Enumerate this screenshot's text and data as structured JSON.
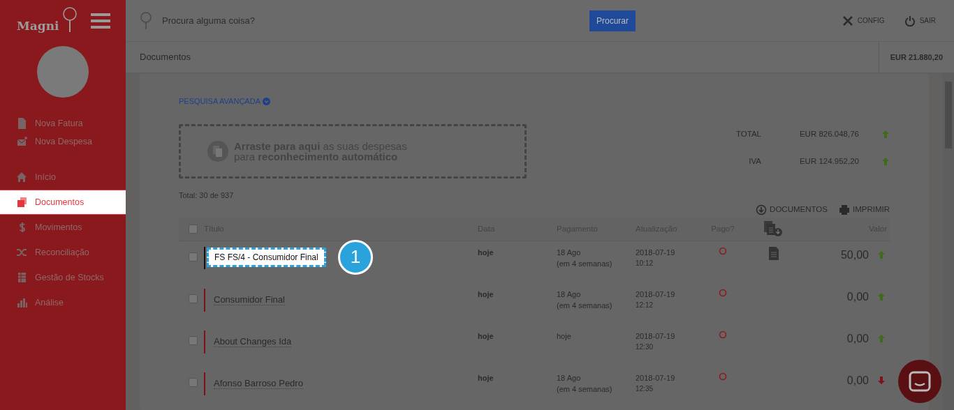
{
  "sidebar": {
    "logo": "Magni",
    "items": [
      {
        "label": "Nova Fatura",
        "selected": false
      },
      {
        "label": "Nova Despesa",
        "selected": false
      },
      {
        "label": "Início",
        "selected": false
      },
      {
        "label": "Documentos",
        "selected": true
      },
      {
        "label": "Movimentos",
        "selected": false
      },
      {
        "label": "Reconciliação",
        "selected": false
      },
      {
        "label": "Gestão de Stocks",
        "selected": false
      },
      {
        "label": "Análise",
        "selected": false
      }
    ]
  },
  "topbar": {
    "search": {
      "placeholder": "Procura alguma coisa?"
    },
    "search_button": "Procurar",
    "actions": [
      {
        "label": "CONFIG"
      },
      {
        "label": "SAIR"
      }
    ]
  },
  "header": {
    "title": "Documentos",
    "balance": "EUR 21.880,20"
  },
  "advanced_search": "PESQUISA AVANÇADA",
  "dropzone": {
    "line_1": "**Arraste para aqui** as suas despesas",
    "line_2": "para **reconhecimento automático**"
  },
  "totals": [
    {
      "label": "TOTAL",
      "value": "EUR 826.048,76",
      "rising": true
    },
    {
      "label": "IVA",
      "value": "EUR 124.952,20",
      "rising": true
    }
  ],
  "count": "Total: 30 de 937",
  "table_actions": [
    {
      "label": "DOCUMENTOS"
    },
    {
      "label": "IMPRIMIR"
    }
  ],
  "table": {
    "select_all_checked": false,
    "columns": [
      {
        "kind": "text",
        "label": "Título"
      },
      {
        "kind": "text",
        "label": "Data"
      },
      {
        "kind": "text",
        "label": "Pagamento"
      },
      {
        "kind": "text",
        "label": "Atualização"
      },
      {
        "kind": "text",
        "label": "Pago?"
      },
      {
        "kind": "icon"
      },
      {
        "kind": "text",
        "label": "Valor"
      }
    ],
    "rows": [
      {
        "checked": false,
        "highlighted": true,
        "title": "FS FS/4 - Consumidor Final",
        "date": "hoje",
        "payment": "18 Ago",
        "payment_note": "(em 4 semanas)",
        "updated_date": "2018-07-19",
        "updated_time": "10:12",
        "paid": false,
        "has_document": true,
        "value": "50,00",
        "rising": true
      },
      {
        "checked": false,
        "highlighted": false,
        "title": "Consumidor Final",
        "date": "hoje",
        "payment": "18 Ago",
        "payment_note": "(em 4 semanas)",
        "updated_date": "2018-07-19",
        "updated_time": "12:12",
        "paid": false,
        "has_document": false,
        "value": "0,00",
        "rising": true
      },
      {
        "checked": false,
        "highlighted": false,
        "title": "About Changes Ida",
        "date": "hoje",
        "payment": "hoje",
        "updated_date": "2018-07-19",
        "updated_time": "12:30",
        "paid": false,
        "has_document": false,
        "value": "0,00",
        "rising": true
      },
      {
        "checked": false,
        "highlighted": false,
        "title": "Afonso Barroso Pedro",
        "date": "hoje",
        "payment": "18 Ago",
        "payment_note": "(em 4 semanas)",
        "updated_date": "2018-07-19",
        "updated_time": "12:35",
        "paid": false,
        "has_document": false,
        "value": "0,00",
        "rising": false
      }
    ]
  },
  "tour": {
    "step": "1"
  }
}
